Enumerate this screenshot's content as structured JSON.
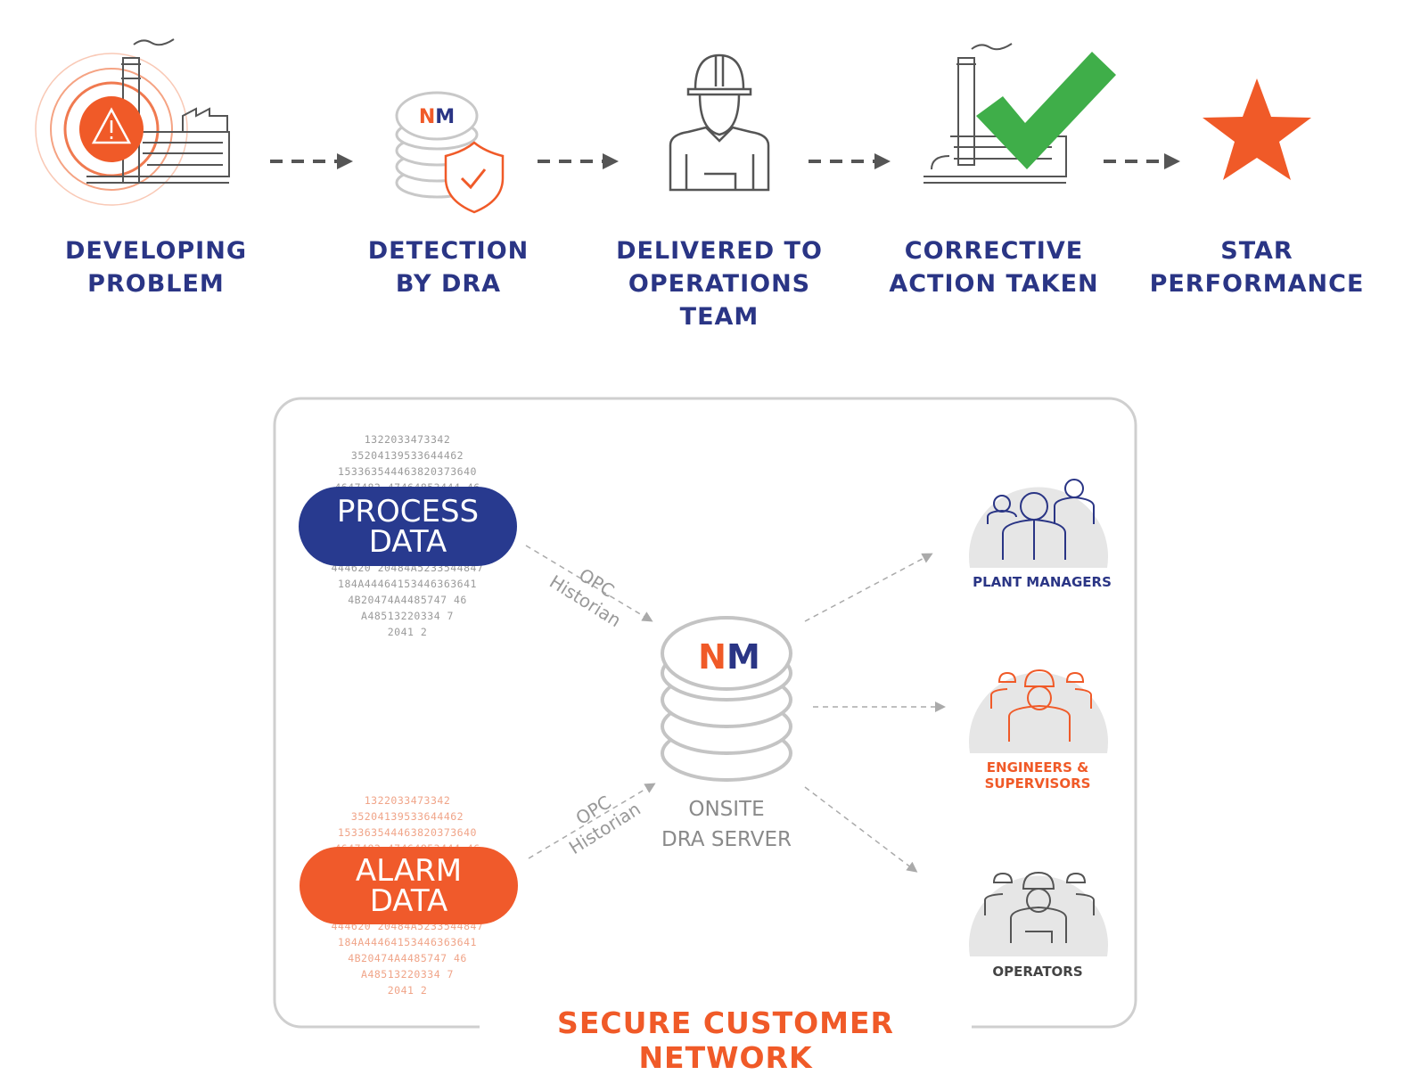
{
  "colors": {
    "navy": "#2a3585",
    "orange": "#f05a28",
    "green": "#3fae49",
    "gray": "#9a9a9a"
  },
  "steps": [
    {
      "label_lines": [
        "DEVELOPING",
        "PROBLEM"
      ],
      "icon": "factory-warning-icon"
    },
    {
      "label_lines": [
        "DETECTION",
        "BY DRA"
      ],
      "icon": "database-shield-icon"
    },
    {
      "label_lines": [
        "DELIVERED TO",
        "OPERATIONS",
        "TEAM"
      ],
      "icon": "worker-icon"
    },
    {
      "label_lines": [
        "CORRECTIVE",
        "ACTION TAKEN"
      ],
      "icon": "factory-check-icon"
    },
    {
      "label_lines": [
        "STAR",
        "PERFORMANCE"
      ],
      "icon": "star-icon"
    }
  ],
  "logo_text": "NM",
  "network": {
    "title": "SECURE CUSTOMER NETWORK",
    "process_data": {
      "lines": [
        "PROCESS",
        "DATA"
      ],
      "numbers_top": [
        "1322033473342",
        "35204139533644462",
        "153363544463820373640",
        "4647482 47464853444 46"
      ],
      "numbers_bottom": [
        "444620 20484A5233544847",
        "184A44464153446363641",
        "4B20474A4485747 46",
        "A48513220334 7",
        "2041 2"
      ]
    },
    "alarm_data": {
      "lines": [
        "ALARM",
        "DATA"
      ],
      "numbers_top": [
        "1322033473342",
        "35204139533644462",
        "153363544463820373640",
        "4647482 47464853444 46"
      ],
      "numbers_bottom": [
        "444620 20484A5233544847",
        "184A44464153446363641",
        "4B20474A4485747 46",
        "A48513220334 7",
        "2041 2"
      ]
    },
    "connector_label_lines": [
      "OPC",
      "Historian"
    ],
    "server": {
      "lines": [
        "ONSITE",
        "DRA SERVER"
      ]
    },
    "groups": [
      {
        "label": "PLANT MANAGERS",
        "color": "#2a3585"
      },
      {
        "label_lines": [
          "ENGINEERS &",
          "SUPERVISORS"
        ],
        "color": "#f05a28"
      },
      {
        "label": "OPERATORS",
        "color": "#444444"
      }
    ]
  }
}
